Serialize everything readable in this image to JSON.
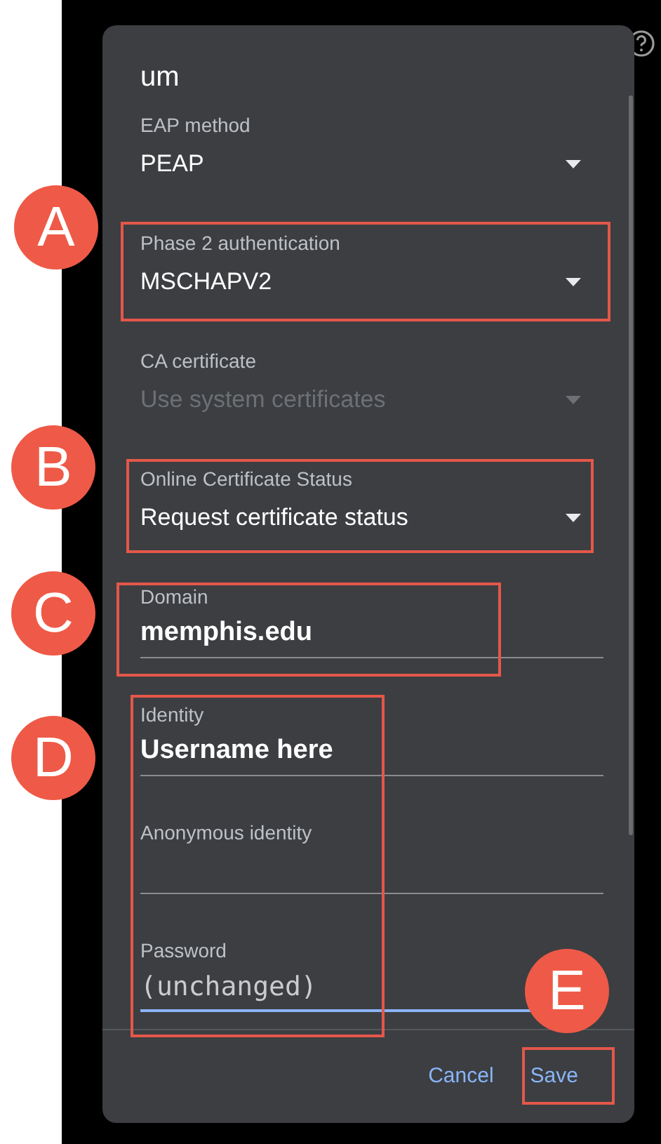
{
  "dialog": {
    "title": "um",
    "fields": [
      {
        "kind": "dropdown",
        "label": "EAP method",
        "value": "PEAP",
        "disabled": false
      },
      {
        "kind": "dropdown",
        "label": "Phase 2 authentication",
        "value": "MSCHAPV2",
        "disabled": false
      },
      {
        "kind": "dropdown",
        "label": "CA certificate",
        "value": "Use system certificates",
        "disabled": true
      },
      {
        "kind": "dropdown",
        "label": "Online Certificate Status",
        "value": "Request certificate status",
        "disabled": false
      },
      {
        "kind": "text",
        "label": "Domain",
        "value": "memphis.edu",
        "focused": false
      },
      {
        "kind": "text",
        "label": "Identity",
        "value": "Username here",
        "focused": false
      },
      {
        "kind": "text",
        "label": "Anonymous identity",
        "focused": false
      },
      {
        "kind": "password",
        "label": "Password",
        "placeholder": "(unchanged)",
        "focused": true
      }
    ],
    "buttons": [
      "Cancel",
      "Save"
    ]
  },
  "annotations": [
    {
      "letter": "A"
    },
    {
      "letter": "B"
    },
    {
      "letter": "C"
    },
    {
      "letter": "D"
    },
    {
      "letter": "E"
    }
  ]
}
